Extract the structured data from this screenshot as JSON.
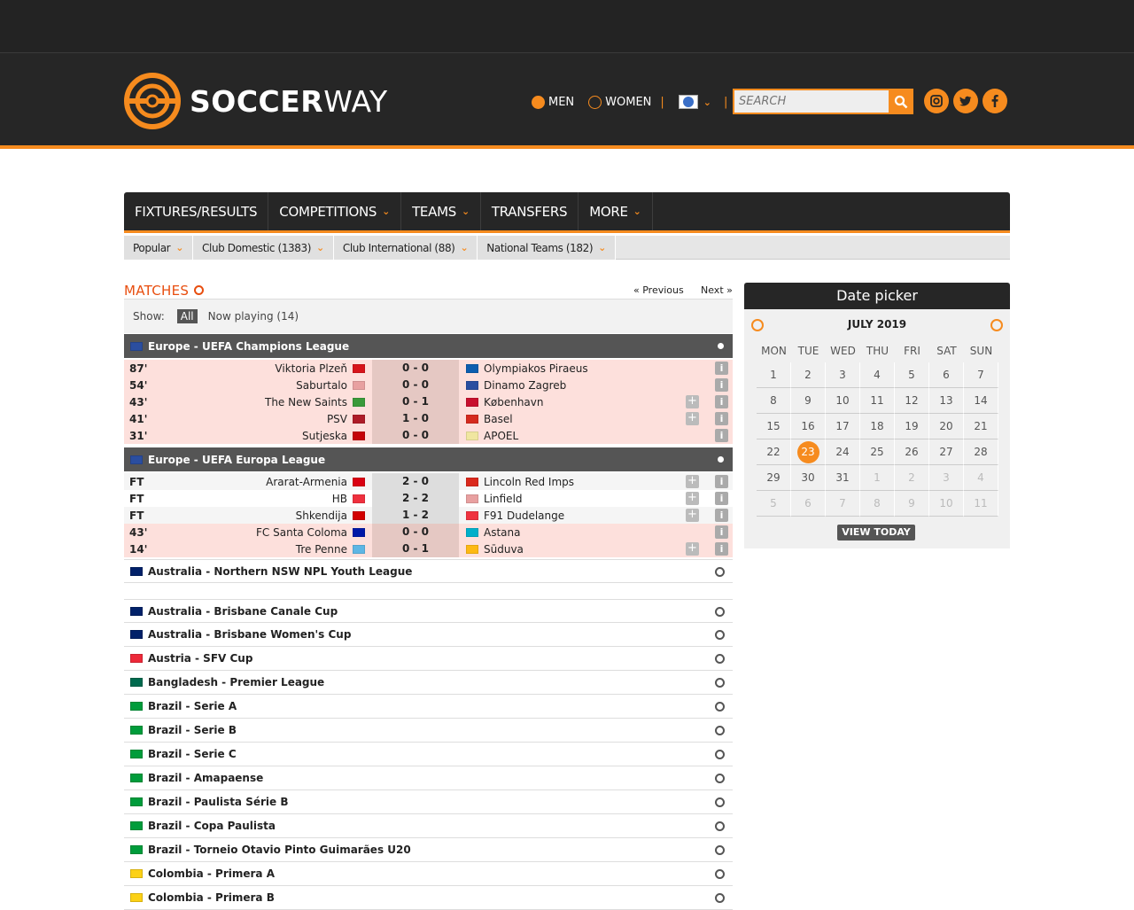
{
  "header": {
    "logo_text": "SOCCERWAY",
    "gender": [
      "MEN",
      "WOMEN"
    ],
    "divider": "|",
    "search_placeholder": "SEARCH",
    "social": [
      "instagram-icon",
      "twitter-icon",
      "facebook-icon"
    ]
  },
  "nav": {
    "items": [
      "FIXTURES/RESULTS",
      "COMPETITIONS",
      "TEAMS",
      "TRANSFERS",
      "MORE"
    ]
  },
  "subnav": {
    "items": [
      "Popular",
      "Club Domestic (1383)",
      "Club International (88)",
      "National Teams (182)"
    ]
  },
  "matches": {
    "title": "MATCHES",
    "previous": "« Previous",
    "next": "Next »",
    "show_label": "Show:",
    "all": "All",
    "now_playing": "Now playing (14)"
  },
  "competitions": [
    {
      "name": "Europe - UEFA Champions League",
      "rows": [
        {
          "time": "87'",
          "home": "Viktoria Plzeň",
          "score": "0 - 0",
          "away": "Olympiakos Piraeus",
          "plus": false,
          "style": "live",
          "hflag": "#d7141a",
          "aflag": "#0d5eaf"
        },
        {
          "time": "54'",
          "home": "Saburtalo",
          "score": "0 - 0",
          "away": "Dinamo Zagreb",
          "plus": false,
          "style": "live",
          "hflag": "#e8a0a0",
          "aflag": "#2b4ea0"
        },
        {
          "time": "43'",
          "home": "The New Saints",
          "score": "0 - 1",
          "away": "København",
          "plus": true,
          "style": "live",
          "hflag": "#3a9a3a",
          "aflag": "#c8102e"
        },
        {
          "time": "41'",
          "home": "PSV",
          "score": "1 - 0",
          "away": "Basel",
          "plus": true,
          "style": "live",
          "hflag": "#ae1c28",
          "aflag": "#d52b1e"
        },
        {
          "time": "31'",
          "home": "Sutjeska",
          "score": "0 - 0",
          "away": "APOEL",
          "plus": false,
          "style": "live",
          "hflag": "#c40308",
          "aflag": "#f0e6a0"
        }
      ]
    },
    {
      "name": "Europe - UEFA Europa League",
      "rows": [
        {
          "time": "FT",
          "home": "Ararat-Armenia",
          "score": "2 - 0",
          "away": "Lincoln Red Imps",
          "plus": true,
          "style": "ft",
          "hflag": "#d90012",
          "aflag": "#da291c"
        },
        {
          "time": "FT",
          "home": "HB",
          "score": "2 - 2",
          "away": "Linfield",
          "plus": true,
          "style": "white",
          "hflag": "#ef303e",
          "aflag": "#e8a0a0"
        },
        {
          "time": "FT",
          "home": "Shkendija",
          "score": "1 - 2",
          "away": "F91 Dudelange",
          "plus": true,
          "style": "ft",
          "hflag": "#d20000",
          "aflag": "#ef3340"
        },
        {
          "time": "43'",
          "home": "FC Santa Coloma",
          "score": "0 - 0",
          "away": "Astana",
          "plus": false,
          "style": "live",
          "hflag": "#0018a8",
          "aflag": "#00afca"
        },
        {
          "time": "14'",
          "home": "Tre Penne",
          "score": "0 - 1",
          "away": "Sūduva",
          "plus": true,
          "style": "live",
          "hflag": "#5eb6e4",
          "aflag": "#fdb913"
        }
      ]
    }
  ],
  "leagues": [
    {
      "name": "Australia - Northern NSW NPL Youth League",
      "flag": "#012169"
    },
    {
      "name": "Australia - Brisbane Canale Cup",
      "flag": "#012169"
    },
    {
      "name": "Australia - Brisbane Women's Cup",
      "flag": "#012169"
    },
    {
      "name": "Austria - SFV Cup",
      "flag": "#ed2939"
    },
    {
      "name": "Bangladesh - Premier League",
      "flag": "#006a4e"
    },
    {
      "name": "Brazil - Serie A",
      "flag": "#009c3b"
    },
    {
      "name": "Brazil - Serie B",
      "flag": "#009c3b"
    },
    {
      "name": "Brazil - Serie C",
      "flag": "#009c3b"
    },
    {
      "name": "Brazil - Amapaense",
      "flag": "#009c3b"
    },
    {
      "name": "Brazil - Paulista Série B",
      "flag": "#009c3b"
    },
    {
      "name": "Brazil - Copa Paulista",
      "flag": "#009c3b"
    },
    {
      "name": "Brazil - Torneio Otavio Pinto Guimarães U20",
      "flag": "#009c3b"
    },
    {
      "name": "Colombia - Primera A",
      "flag": "#fcd116"
    },
    {
      "name": "Colombia - Primera B",
      "flag": "#fcd116"
    }
  ],
  "datepicker": {
    "title": "Date picker",
    "month": "JULY 2019",
    "weekdays": [
      "MON",
      "TUE",
      "WED",
      "THU",
      "FRI",
      "SAT",
      "SUN"
    ],
    "weeks": [
      [
        "1",
        "2",
        "3",
        "4",
        "5",
        "6",
        "7"
      ],
      [
        "8",
        "9",
        "10",
        "11",
        "12",
        "13",
        "14"
      ],
      [
        "15",
        "16",
        "17",
        "18",
        "19",
        "20",
        "21"
      ],
      [
        "22",
        "23",
        "24",
        "25",
        "26",
        "27",
        "28"
      ],
      [
        "29",
        "30",
        "31",
        "1",
        "2",
        "3",
        "4"
      ],
      [
        "5",
        "6",
        "7",
        "8",
        "9",
        "10",
        "11"
      ]
    ],
    "today": "23",
    "view_today": "VIEW TODAY"
  },
  "colors": {
    "accent": "#f68b1e",
    "dark": "#262626",
    "live_row": "#fde0dc"
  }
}
